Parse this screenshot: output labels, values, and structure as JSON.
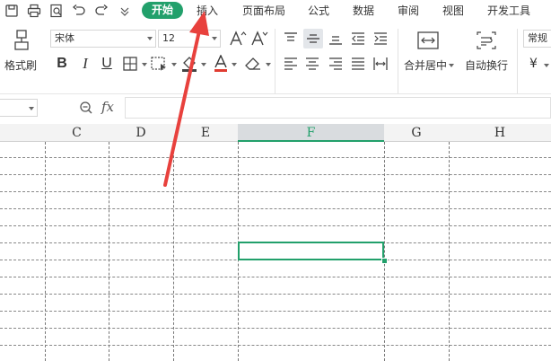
{
  "menu": {
    "tabs": [
      "开始",
      "插入",
      "页面布局",
      "公式",
      "数据",
      "审阅",
      "视图",
      "开发工具"
    ],
    "active_tab": "开始"
  },
  "ribbon": {
    "format_painter_label": "格式刷",
    "font_name": "宋体",
    "font_size": "12",
    "merge_center_label": "合并居中",
    "wrap_text_label": "自动换行",
    "number_format": "常规",
    "currency_symbol": "¥"
  },
  "formula_bar": {
    "fx_label": "fx",
    "value": ""
  },
  "columns": [
    "C",
    "D",
    "E",
    "F",
    "G",
    "H"
  ],
  "selected_column": "F",
  "colors": {
    "accent": "#22a06b",
    "arrow": "#e8413d"
  }
}
